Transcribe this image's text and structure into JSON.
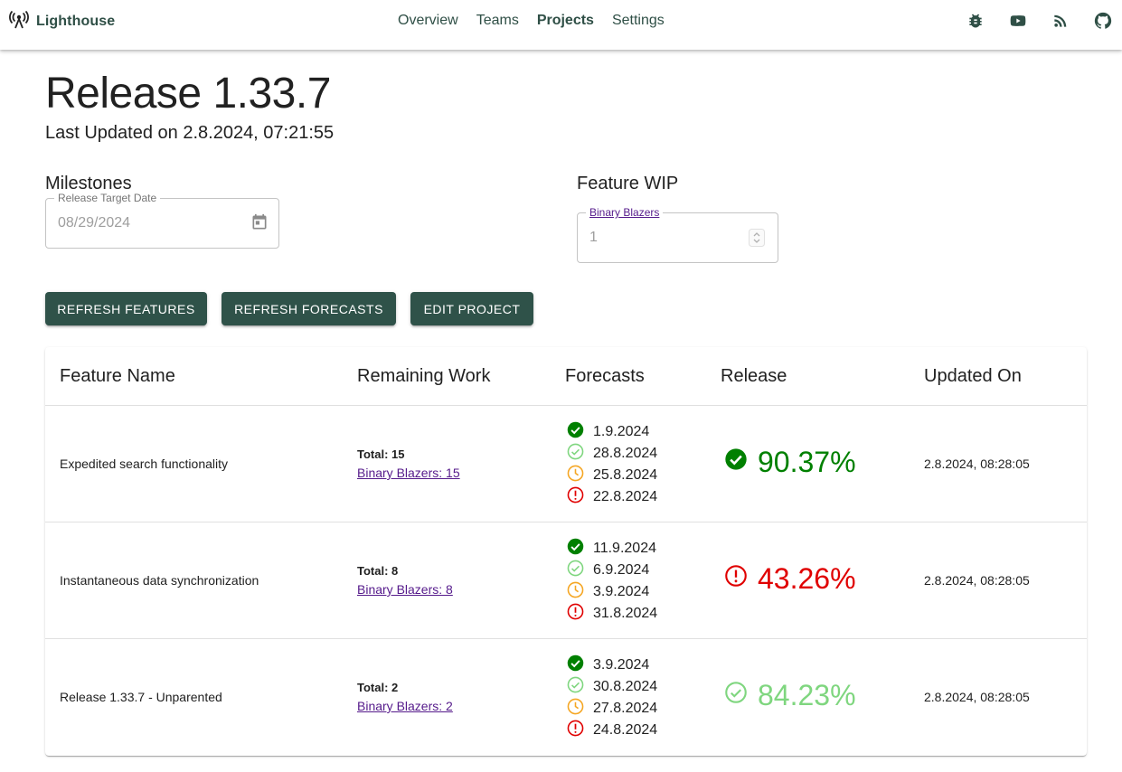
{
  "app": {
    "brand": "Lighthouse",
    "nav": [
      {
        "label": "Overview"
      },
      {
        "label": "Teams"
      },
      {
        "label": "Projects"
      },
      {
        "label": "Settings"
      }
    ],
    "header_icons": [
      "bug-icon",
      "youtube-icon",
      "rss-icon",
      "github-icon"
    ]
  },
  "page": {
    "title": "Release 1.33.7",
    "last_updated": "Last Updated on 2.8.2024, 07:21:55"
  },
  "milestones": {
    "label": "Milestones",
    "field_label": "Release Target Date",
    "value": "08/29/2024"
  },
  "wip": {
    "label": "Feature WIP",
    "field_label": "Binary Blazers",
    "value": "1"
  },
  "buttons": {
    "refresh_features": "REFRESH FEATURES",
    "refresh_forecasts": "REFRESH FORECASTS",
    "edit_project": "EDIT PROJECT"
  },
  "table": {
    "headers": [
      "Feature Name",
      "Remaining Work",
      "Forecasts",
      "Release",
      "Updated On"
    ],
    "rows": [
      {
        "name": "Expedited search functionality",
        "total": "Total: 15",
        "team_link": "Binary Blazers: 15",
        "forecasts": [
          "1.9.2024",
          "28.8.2024",
          "25.8.2024",
          "22.8.2024"
        ],
        "release_pct": "90.37%",
        "release_status": "certain",
        "updated": "2.8.2024, 08:28:05"
      },
      {
        "name": "Instantaneous data synchronization",
        "total": "Total: 8",
        "team_link": "Binary Blazers: 8",
        "forecasts": [
          "11.9.2024",
          "6.9.2024",
          "3.9.2024",
          "31.8.2024"
        ],
        "release_pct": "43.26%",
        "release_status": "risky",
        "updated": "2.8.2024, 08:28:05"
      },
      {
        "name": "Release 1.33.7 - Unparented",
        "total": "Total: 2",
        "team_link": "Binary Blazers: 2",
        "forecasts": [
          "3.9.2024",
          "30.8.2024",
          "27.8.2024",
          "24.8.2024"
        ],
        "release_pct": "84.23%",
        "release_status": "likely",
        "updated": "2.8.2024, 08:28:05"
      }
    ]
  },
  "colors": {
    "primary": "#2f5249",
    "certain": "#008000",
    "likely": "#7fd67f",
    "realistic": "#f5a623",
    "risky": "#e00000"
  }
}
